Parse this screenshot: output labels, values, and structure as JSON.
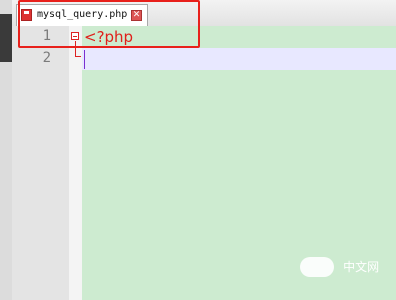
{
  "tab": {
    "label": "mysql_query.php",
    "close_glyph": "✕",
    "save_icon": "save-icon"
  },
  "gutter": {
    "line_numbers": [
      "1",
      "2"
    ]
  },
  "code": {
    "line1": "<?php",
    "line2": ""
  },
  "watermark": {
    "text": "中文网"
  },
  "colors": {
    "editor_bg": "#cdebd0",
    "current_line": "#e8e8ff",
    "highlight_box": "#e8201b",
    "php_tag": "#e0201b"
  }
}
